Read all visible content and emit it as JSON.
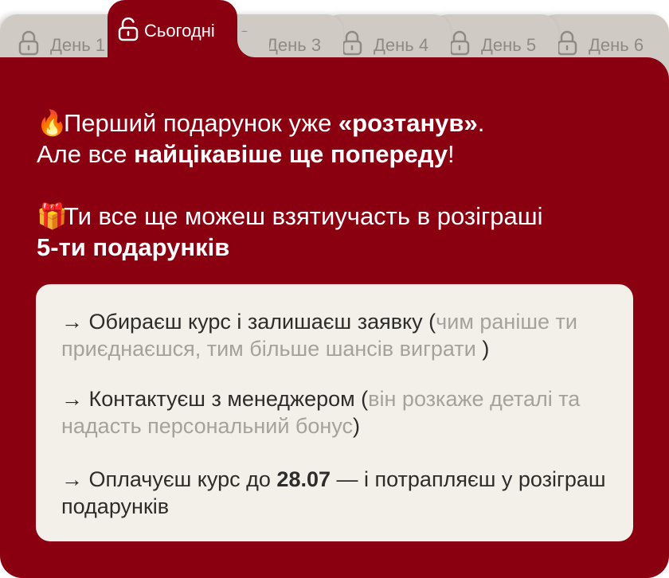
{
  "tabs": [
    {
      "label": "День 1"
    },
    {
      "label": "Сьогодні"
    },
    {
      "label": "День 3"
    },
    {
      "label": "День 4"
    },
    {
      "label": "День 5"
    },
    {
      "label": "День 6"
    }
  ],
  "colors": {
    "accent": "#8b0011",
    "card": "#f3f0ea",
    "tab_inactive": "#cfcbc4"
  },
  "message": {
    "line1_emoji": "🔥",
    "line1_a": "Перший подарунок уже ",
    "line1_bold": "«розтанув»",
    "line1_b": ".",
    "line2_a": "Але все ",
    "line2_bold": "найцікавіше ще попереду",
    "line2_b": "!",
    "line3_emoji": "🎁",
    "line3_a": "Ти все ще можеш взятиучасть в розіграші",
    "line4_bold": "5-ти подарунків"
  },
  "steps": [
    {
      "main": "→ Обираєш курс і залишаєш заявку (",
      "muted": "чим раніше ти приєднаєшся, тим більше шансів виграти ",
      "end": ")"
    },
    {
      "main": "→ Контактуєш з менеджером (",
      "muted": "він розкаже деталі та надасть персональний бонус",
      "end": ")"
    },
    {
      "main_a": "→ Оплачуєш курс до ",
      "main_bold": "28.07",
      "main_b": " — і потрапляєш у розіграш подарунків"
    }
  ]
}
